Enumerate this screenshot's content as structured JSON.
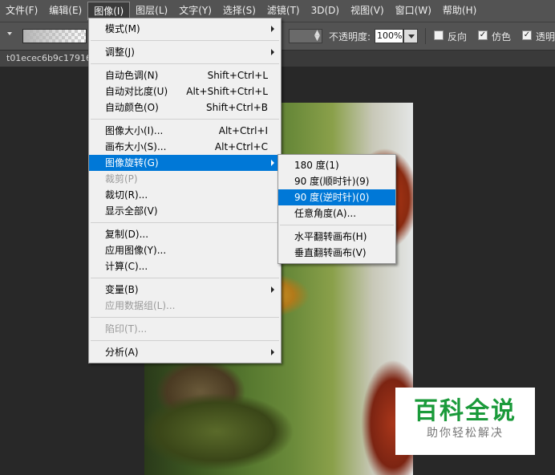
{
  "menubar": {
    "items": [
      "文件(F)",
      "编辑(E)",
      "图像(I)",
      "图层(L)",
      "文字(Y)",
      "选择(S)",
      "滤镜(T)",
      "3D(D)",
      "视图(V)",
      "窗口(W)",
      "帮助(H)"
    ],
    "active_index": 2
  },
  "options": {
    "opacity_label": "不透明度:",
    "opacity_value": "100%",
    "reverse_label": "反向",
    "dither_label": "仿色",
    "transparency_label": "透明",
    "check_mark": "✓"
  },
  "document": {
    "tab_name": "t01ecec6b9c17916"
  },
  "image_menu": {
    "items": [
      {
        "label": "模式(M)",
        "shortcut": "",
        "submenu": true,
        "disabled": false
      },
      {
        "divider": true
      },
      {
        "label": "调整(J)",
        "shortcut": "",
        "submenu": true,
        "disabled": false
      },
      {
        "divider": true
      },
      {
        "label": "自动色调(N)",
        "shortcut": "Shift+Ctrl+L",
        "submenu": false,
        "disabled": false
      },
      {
        "label": "自动对比度(U)",
        "shortcut": "Alt+Shift+Ctrl+L",
        "submenu": false,
        "disabled": false
      },
      {
        "label": "自动颜色(O)",
        "shortcut": "Shift+Ctrl+B",
        "submenu": false,
        "disabled": false
      },
      {
        "divider": true
      },
      {
        "label": "图像大小(I)...",
        "shortcut": "Alt+Ctrl+I",
        "submenu": false,
        "disabled": false
      },
      {
        "label": "画布大小(S)...",
        "shortcut": "Alt+Ctrl+C",
        "submenu": false,
        "disabled": false
      },
      {
        "label": "图像旋转(G)",
        "shortcut": "",
        "submenu": true,
        "disabled": false,
        "highlighted": true
      },
      {
        "label": "裁剪(P)",
        "shortcut": "",
        "submenu": false,
        "disabled": true
      },
      {
        "label": "裁切(R)...",
        "shortcut": "",
        "submenu": false,
        "disabled": false
      },
      {
        "label": "显示全部(V)",
        "shortcut": "",
        "submenu": false,
        "disabled": false
      },
      {
        "divider": true
      },
      {
        "label": "复制(D)...",
        "shortcut": "",
        "submenu": false,
        "disabled": false
      },
      {
        "label": "应用图像(Y)...",
        "shortcut": "",
        "submenu": false,
        "disabled": false
      },
      {
        "label": "计算(C)...",
        "shortcut": "",
        "submenu": false,
        "disabled": false
      },
      {
        "divider": true
      },
      {
        "label": "变量(B)",
        "shortcut": "",
        "submenu": true,
        "disabled": false
      },
      {
        "label": "应用数据组(L)...",
        "shortcut": "",
        "submenu": false,
        "disabled": true
      },
      {
        "divider": true
      },
      {
        "label": "陷印(T)...",
        "shortcut": "",
        "submenu": false,
        "disabled": true
      },
      {
        "divider": true
      },
      {
        "label": "分析(A)",
        "shortcut": "",
        "submenu": true,
        "disabled": false
      }
    ]
  },
  "rotate_submenu": {
    "items": [
      {
        "label": "180 度(1)"
      },
      {
        "label": "90 度(顺时针)(9)"
      },
      {
        "label": "90 度(逆时针)(0)",
        "highlighted": true
      },
      {
        "label": "任意角度(A)..."
      },
      {
        "divider": true
      },
      {
        "label": "水平翻转画布(H)"
      },
      {
        "label": "垂直翻转画布(V)"
      }
    ]
  },
  "watermark": {
    "title": "百科全说",
    "subtitle": "助你轻松解决"
  }
}
